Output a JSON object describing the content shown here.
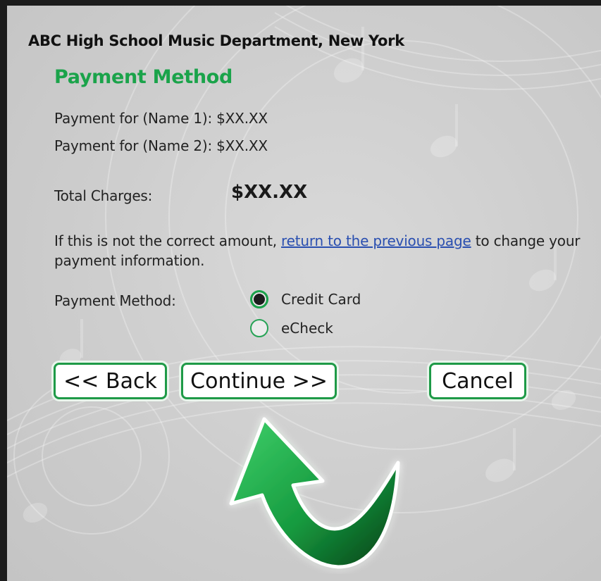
{
  "header": {
    "organization": "ABC High School Music Department, New York",
    "section_title": "Payment Method"
  },
  "payments": [
    {
      "label": "Payment for (Name 1): $XX.XX"
    },
    {
      "label": "Payment for (Name 2): $XX.XX"
    }
  ],
  "total": {
    "label": "Total Charges:",
    "amount": "$XX.XX"
  },
  "note": {
    "prefix": "If this is not the correct amount, ",
    "link_text": "return to the previous page",
    "suffix": " to change your payment information."
  },
  "payment_method": {
    "label": "Payment Method:",
    "options": [
      {
        "label": "Credit Card",
        "selected": true
      },
      {
        "label": "eCheck",
        "selected": false
      }
    ]
  },
  "buttons": {
    "back": "<< Back",
    "continue": "Continue >>",
    "cancel": "Cancel"
  },
  "colors": {
    "accent_green": "#1aa34a",
    "link_blue": "#2a4fb0",
    "panel_gray": "#d2d2d2"
  },
  "icons": {
    "arrow": "curved-arrow-up-icon"
  }
}
